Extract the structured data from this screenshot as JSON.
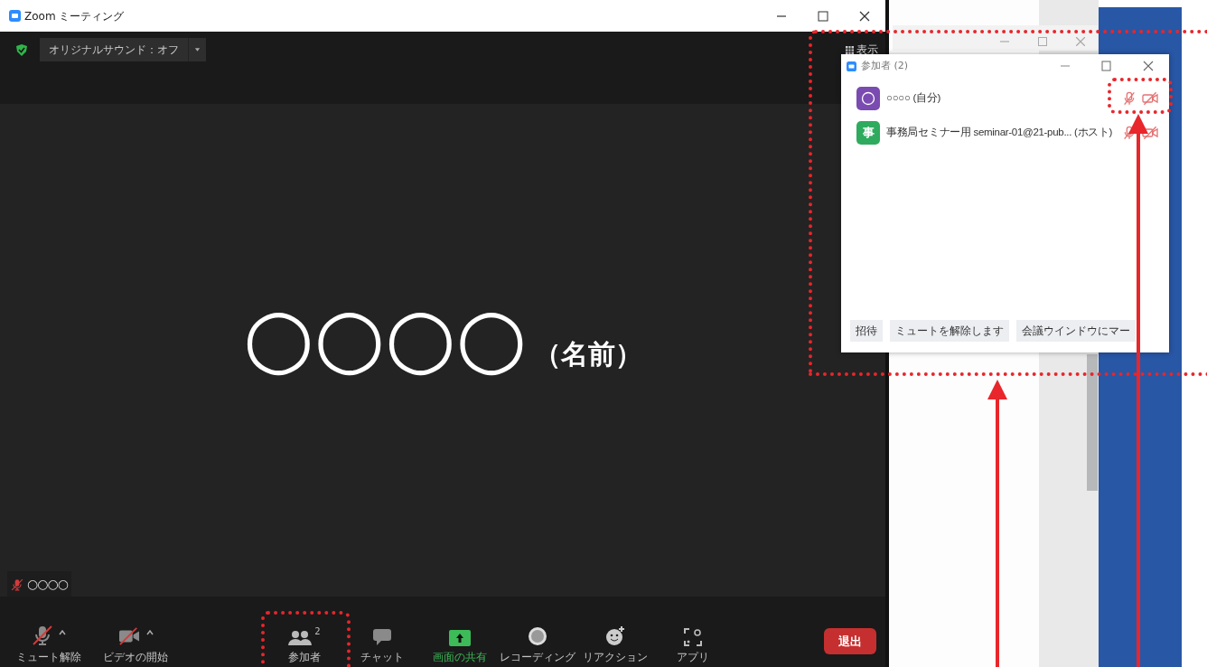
{
  "window": {
    "title": "Zoom ミーティング"
  },
  "top_bar": {
    "sound_button": "オリジナルサウンド：オフ",
    "view_button": "表示"
  },
  "video": {
    "name": "○○○○",
    "suffix": "（名前）"
  },
  "name_tag": {
    "name": "○○○○",
    "muted": true
  },
  "toolbar": {
    "items": [
      {
        "kind": "mic",
        "label": "ミュート解除",
        "off": true,
        "caret": true
      },
      {
        "kind": "video",
        "label": "ビデオの開始",
        "off": true,
        "caret": true
      },
      {
        "kind": "participants",
        "label": "参加者",
        "count": "2"
      },
      {
        "kind": "chat",
        "label": "チャット"
      },
      {
        "kind": "share",
        "label": "画面の共有"
      },
      {
        "kind": "record",
        "label": "レコーディング"
      },
      {
        "kind": "reaction",
        "label": "リアクション"
      },
      {
        "kind": "apps",
        "label": "アプリ"
      }
    ],
    "leave_button": "退出"
  },
  "participants_window": {
    "title": "参加者 (2)",
    "participants": [
      {
        "color": "#7a4bb0",
        "name": "○○○○ (自分)",
        "mic_muted": true,
        "video_off": true
      },
      {
        "avatar": "事",
        "color": "#2eab5e",
        "name": "事務局セミナー用 seminar-01@21-pub... (ホスト)",
        "mic_muted": true,
        "video_off": true
      }
    ],
    "buttons": [
      "招待",
      "ミュートを解除します",
      "会議ウインドウにマー"
    ]
  }
}
